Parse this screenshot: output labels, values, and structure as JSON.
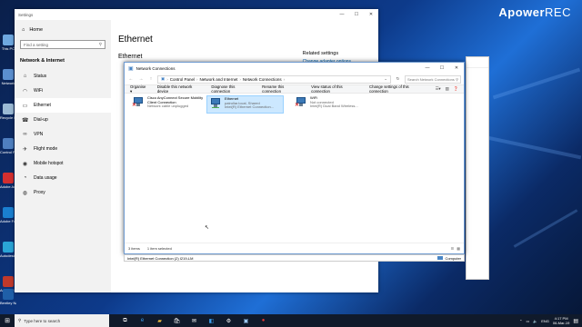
{
  "watermark": {
    "brand": "Apower",
    "suffix": "REC"
  },
  "desktop_icons": [
    {
      "label": "This PC",
      "icon": "this-pc-icon",
      "color": "#6ea8e0"
    },
    {
      "label": "Network",
      "icon": "network-icon",
      "color": "#5b8fd0"
    },
    {
      "label": "Recycle Bin",
      "icon": "recycle-bin-icon",
      "color": "#9bbad4"
    },
    {
      "label": "Control Panel",
      "icon": "control-panel-icon",
      "color": "#4f7fc0"
    },
    {
      "label": "Adobe Acrobat",
      "icon": "acrobat-icon",
      "color": "#d32f2f"
    },
    {
      "label": "Adobe FormsC.",
      "icon": "forms-central-icon",
      "color": "#1a7fd0"
    },
    {
      "label": "Autodesk Desktop",
      "icon": "autodesk-icon",
      "color": "#2aa4d6"
    },
    {
      "label": "Adobe ReCap",
      "icon": "recap-icon",
      "color": "#c0392b"
    },
    {
      "label": "Bentley Navigator",
      "icon": "navigator-icon",
      "color": "#1f5fa8"
    }
  ],
  "settings": {
    "title": "Settings",
    "home": "Home",
    "search_placeholder": "Find a setting",
    "section": "Network & Internet",
    "nav": [
      {
        "label": "Status",
        "icon": "⌂",
        "name": "status-icon"
      },
      {
        "label": "WiFi",
        "icon": "◠",
        "name": "wifi-icon"
      },
      {
        "label": "Ethernet",
        "icon": "▭",
        "name": "ethernet-icon",
        "active": true
      },
      {
        "label": "Dial-up",
        "icon": "☎",
        "name": "dialup-icon"
      },
      {
        "label": "VPN",
        "icon": "∞",
        "name": "vpn-icon"
      },
      {
        "label": "Flight mode",
        "icon": "✈",
        "name": "flight-mode-icon"
      },
      {
        "label": "Mobile hotspot",
        "icon": "◉",
        "name": "hotspot-icon"
      },
      {
        "label": "Data usage",
        "icon": "◔",
        "name": "data-usage-icon"
      },
      {
        "label": "Proxy",
        "icon": "◍",
        "name": "proxy-icon"
      }
    ],
    "page_title": "Ethernet",
    "subheading": "Ethernet",
    "related_title": "Related settings",
    "related_link": "Change adapter options"
  },
  "netwin": {
    "title": "Network Connections",
    "breadcrumb": [
      "Control Panel",
      "Network and Internet",
      "Network Connections"
    ],
    "search_placeholder": "Search Network Connections",
    "commands": [
      "Organise ▾",
      "Disable this network device",
      "Diagnose this connection",
      "Rename this connection",
      "View status of this connection",
      "Change settings of this connection"
    ],
    "connections": [
      {
        "name": "Cisco AnyConnect Secure Mobility Client Connection",
        "status": "Network cable unplugged",
        "device": "",
        "selected": false,
        "error": true
      },
      {
        "name": "Ethernet",
        "status": "patrollar.local, Shared",
        "device": "Intel(R) Ethernet Connection...",
        "selected": true,
        "error": false
      },
      {
        "name": "WiFi",
        "status": "Not connected",
        "device": "Intel(R) Dual Band Wireless...",
        "selected": false,
        "error": true
      }
    ],
    "status_count": "3 items",
    "status_selected": "1 item selected",
    "details_left": "Intel(R) Ethernet Connection (2) I219-LM",
    "details_right": "Computer"
  },
  "taskbar": {
    "search_placeholder": "Type here to search",
    "lang": "ENG",
    "time": "4:17 PM",
    "date": "06-Mar-19"
  }
}
